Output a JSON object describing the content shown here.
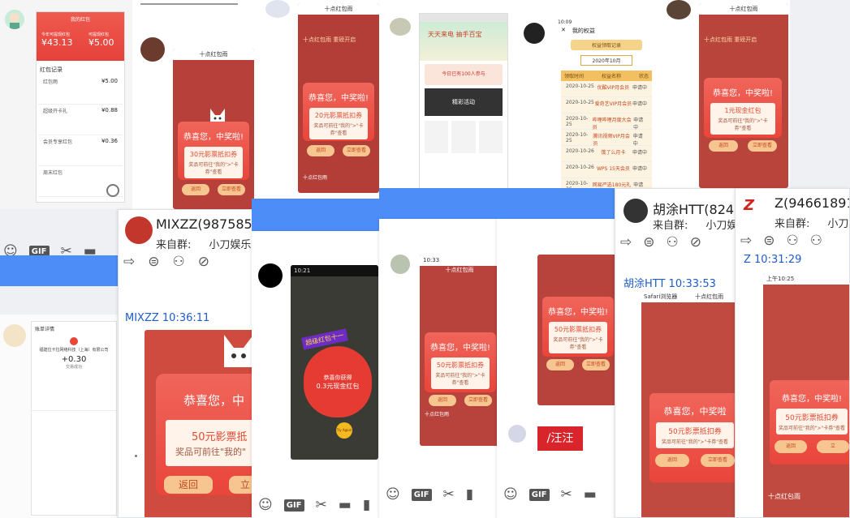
{
  "colors": {
    "blue": "#4d8df7",
    "red": "#e9453b",
    "timestamp": "#1f5cc7"
  },
  "app_title": "十点红包雨",
  "popup": {
    "congrats": "恭喜您，中奖啦!",
    "congrats_alt": "恭喜您，中奖啦",
    "hint": "奖品可前往\"我的\">\"卡券\"查看",
    "back": "返回",
    "view": "立即查看",
    "prize_30": "30元影票抵扣券",
    "prize_20": "20元影票抵扣券",
    "prize_50": "50元影票抵扣券",
    "prize_1": "1元现金红包",
    "congrats_big": "恭喜您，中",
    "prize_50_cut": "50元影票抵",
    "hint_cut": "奖品可前往\"我的\"",
    "view_cut": "立",
    "bottom": "十点红包雨"
  },
  "redpacket_page": {
    "header_left": "我的红包",
    "balance_left_label": "今年可提现红包",
    "balance_left": "¥43.13",
    "balance_right_label": "可提现红包",
    "balance_right": "¥5.00",
    "records_title": "红包记录",
    "rows": [
      {
        "name": "红包雨",
        "amount": "¥5.00"
      },
      {
        "name": "超级开卡礼",
        "amount": "¥0.88"
      },
      {
        "name": "会员专享红包",
        "amount": "¥0.36"
      },
      {
        "name": "周末红包",
        "amount": ""
      }
    ]
  },
  "benefits_page": {
    "title": "我的权益",
    "subtitle": "权益领取记录",
    "month": "2020年10月",
    "cols": [
      "领取时间",
      "权益名称",
      "状态"
    ],
    "rows": [
      {
        "date": "2020-10-25",
        "name": "优酷VIP月会员",
        "state": "申请中"
      },
      {
        "date": "2020-10-25",
        "name": "爱奇艺VIP月会员",
        "state": "申请中"
      },
      {
        "date": "2020-10-25",
        "name": "哔哩哔哩月度大会员",
        "state": "申请中"
      },
      {
        "date": "2020-10-25",
        "name": "腾讯视频VIP月会员",
        "state": "申请中"
      },
      {
        "date": "2020-10-26",
        "name": "饿了么月卡",
        "state": "申请中"
      },
      {
        "date": "2020-10-26",
        "name": "WPS 15天会员",
        "state": "申请中"
      },
      {
        "date": "2020-10-26",
        "name": "网易严选180元礼包",
        "state": "申请中"
      }
    ]
  },
  "bill_page": {
    "title": "账单详情",
    "company": "福建拉卡拉网络科技（上海）有限公司",
    "amount": "+0.30",
    "status": "交易成功"
  },
  "activity_page": {
    "header": "天天来电 抽手百宝",
    "sub": "今日已有100人参与",
    "banner": "精彩活动"
  },
  "rain_game": {
    "tag": "超级红包十一",
    "win_text": "恭喜你获得",
    "win_prize": "0.3元现金红包",
    "try_again": "Try Again"
  },
  "chats": [
    {
      "name": "MIXZZ(987585",
      "from_label": "来自群:",
      "group": "小刀娱乐网",
      "time": "MIXZZ  10:36:11"
    },
    {
      "name": "胡涂HTT(824",
      "from_label": "来自群:",
      "group": "小刀娱乐",
      "time": "胡涂HTT  10:33:53"
    },
    {
      "name": "Z(94661891",
      "from_label": "来自群:",
      "group": "小刀娱",
      "time": "Z  10:31:29"
    }
  ],
  "sticker_text": "/汪汪",
  "status_bars": {
    "a": "10:33",
    "b": "上午10:25",
    "c": "10:09",
    "d": "10:21"
  },
  "browser": {
    "safari": "Safari浏览器"
  },
  "icons": [
    "smile-icon",
    "gif-icon",
    "scissors-icon",
    "folder-icon",
    "image-icon",
    "share-icon",
    "at-icon",
    "add-user-icon",
    "block-user-icon",
    "magnifier-icon",
    "close-icon",
    "back-icon"
  ]
}
